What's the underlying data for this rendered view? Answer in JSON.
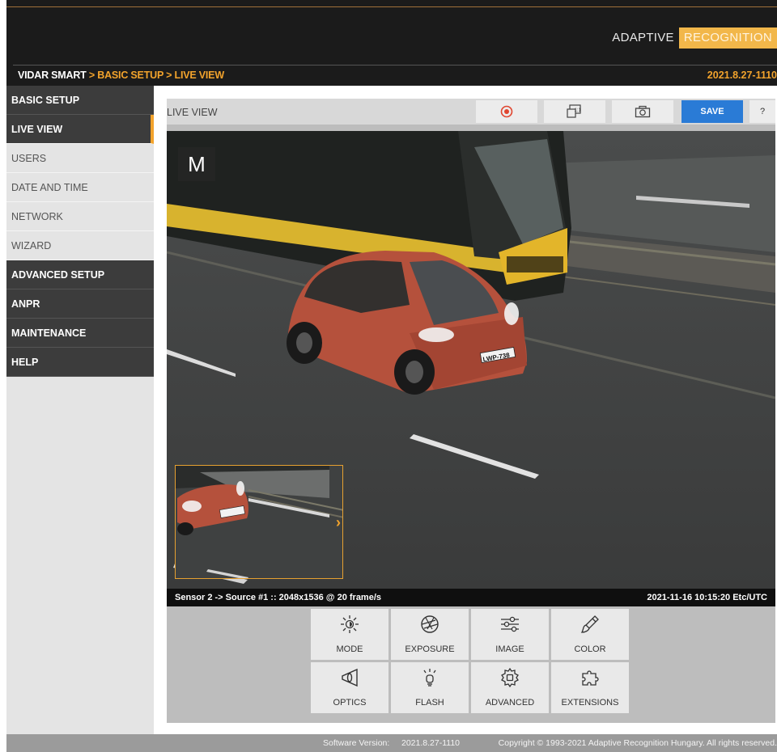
{
  "header": {
    "logo_part1": "ADAPTIVE",
    "logo_part2": "RECOGNITION",
    "breadcrumb_root": "VIDAR SMART",
    "breadcrumb_rest": " > BASIC SETUP > LIVE VIEW",
    "version": "2021.8.27-1110",
    "colors": {
      "accent": "#f2a32c",
      "topbar": "#1b1b1b",
      "save": "#2a7bd6"
    }
  },
  "sidebar": {
    "items": [
      {
        "label": "BASIC SETUP",
        "style": "dark"
      },
      {
        "label": "LIVE VIEW",
        "style": "active"
      },
      {
        "label": "USERS",
        "style": "light"
      },
      {
        "label": "DATE AND TIME",
        "style": "light"
      },
      {
        "label": "NETWORK",
        "style": "light"
      },
      {
        "label": "WIZARD",
        "style": "light"
      },
      {
        "label": "ADVANCED SETUP",
        "style": "dark"
      },
      {
        "label": "ANPR",
        "style": "dark"
      },
      {
        "label": "MAINTENANCE",
        "style": "dark"
      },
      {
        "label": "HELP",
        "style": "dark"
      }
    ]
  },
  "main": {
    "title": "LIVE VIEW",
    "toolbar": {
      "record_icon": "record-icon",
      "zoom_icon": "one-to-one-zoom-icon",
      "snapshot_icon": "camera-icon",
      "save_label": "SAVE",
      "help_label": "?"
    },
    "video": {
      "mode_badge": "M",
      "plate_text": "LWP-738",
      "info_left": "Sensor 2 -> Source #1 :: 2048x1536 @ 20 frame/s",
      "info_right": "2021-11-16 10:15:20 Etc/UTC"
    },
    "tools": [
      {
        "label": "MODE",
        "icon": "sun-mode-icon"
      },
      {
        "label": "EXPOSURE",
        "icon": "aperture-icon"
      },
      {
        "label": "IMAGE",
        "icon": "sliders-icon"
      },
      {
        "label": "COLOR",
        "icon": "color-brush-icon"
      },
      {
        "label": "OPTICS",
        "icon": "optics-icon"
      },
      {
        "label": "FLASH",
        "icon": "flash-bulb-icon"
      },
      {
        "label": "ADVANCED",
        "icon": "gear-chip-icon"
      },
      {
        "label": "EXTENSIONS",
        "icon": "puzzle-icon"
      }
    ]
  },
  "footer": {
    "software_label": "Software Version:",
    "software_version": "2021.8.27-1110",
    "copyright": "Copyright © 1993-2021 Adaptive Recognition Hungary. All rights reserved."
  }
}
